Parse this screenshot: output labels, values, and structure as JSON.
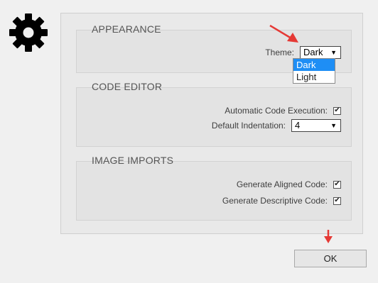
{
  "appearance": {
    "title": "APPEARANCE",
    "theme_label": "Theme:",
    "theme_value": "Dark",
    "theme_options": [
      "Dark",
      "Light"
    ]
  },
  "code_editor": {
    "title": "CODE EDITOR",
    "auto_exec_label": "Automatic Code Execution:",
    "auto_exec_checked": true,
    "indent_label": "Default Indentation:",
    "indent_value": "4"
  },
  "image_imports": {
    "title": "IMAGE IMPORTS",
    "aligned_label": "Generate Aligned Code:",
    "aligned_checked": true,
    "descriptive_label": "Generate Descriptive Code:",
    "descriptive_checked": true
  },
  "ok_label": "OK",
  "icons": {
    "settings": "gear-icon",
    "dropdown": "triangle-down",
    "check": "checkmark",
    "annotation": "red-arrow"
  },
  "colors": {
    "selected_option": "#1e8ef5",
    "annotation_arrow": "#e53935"
  }
}
